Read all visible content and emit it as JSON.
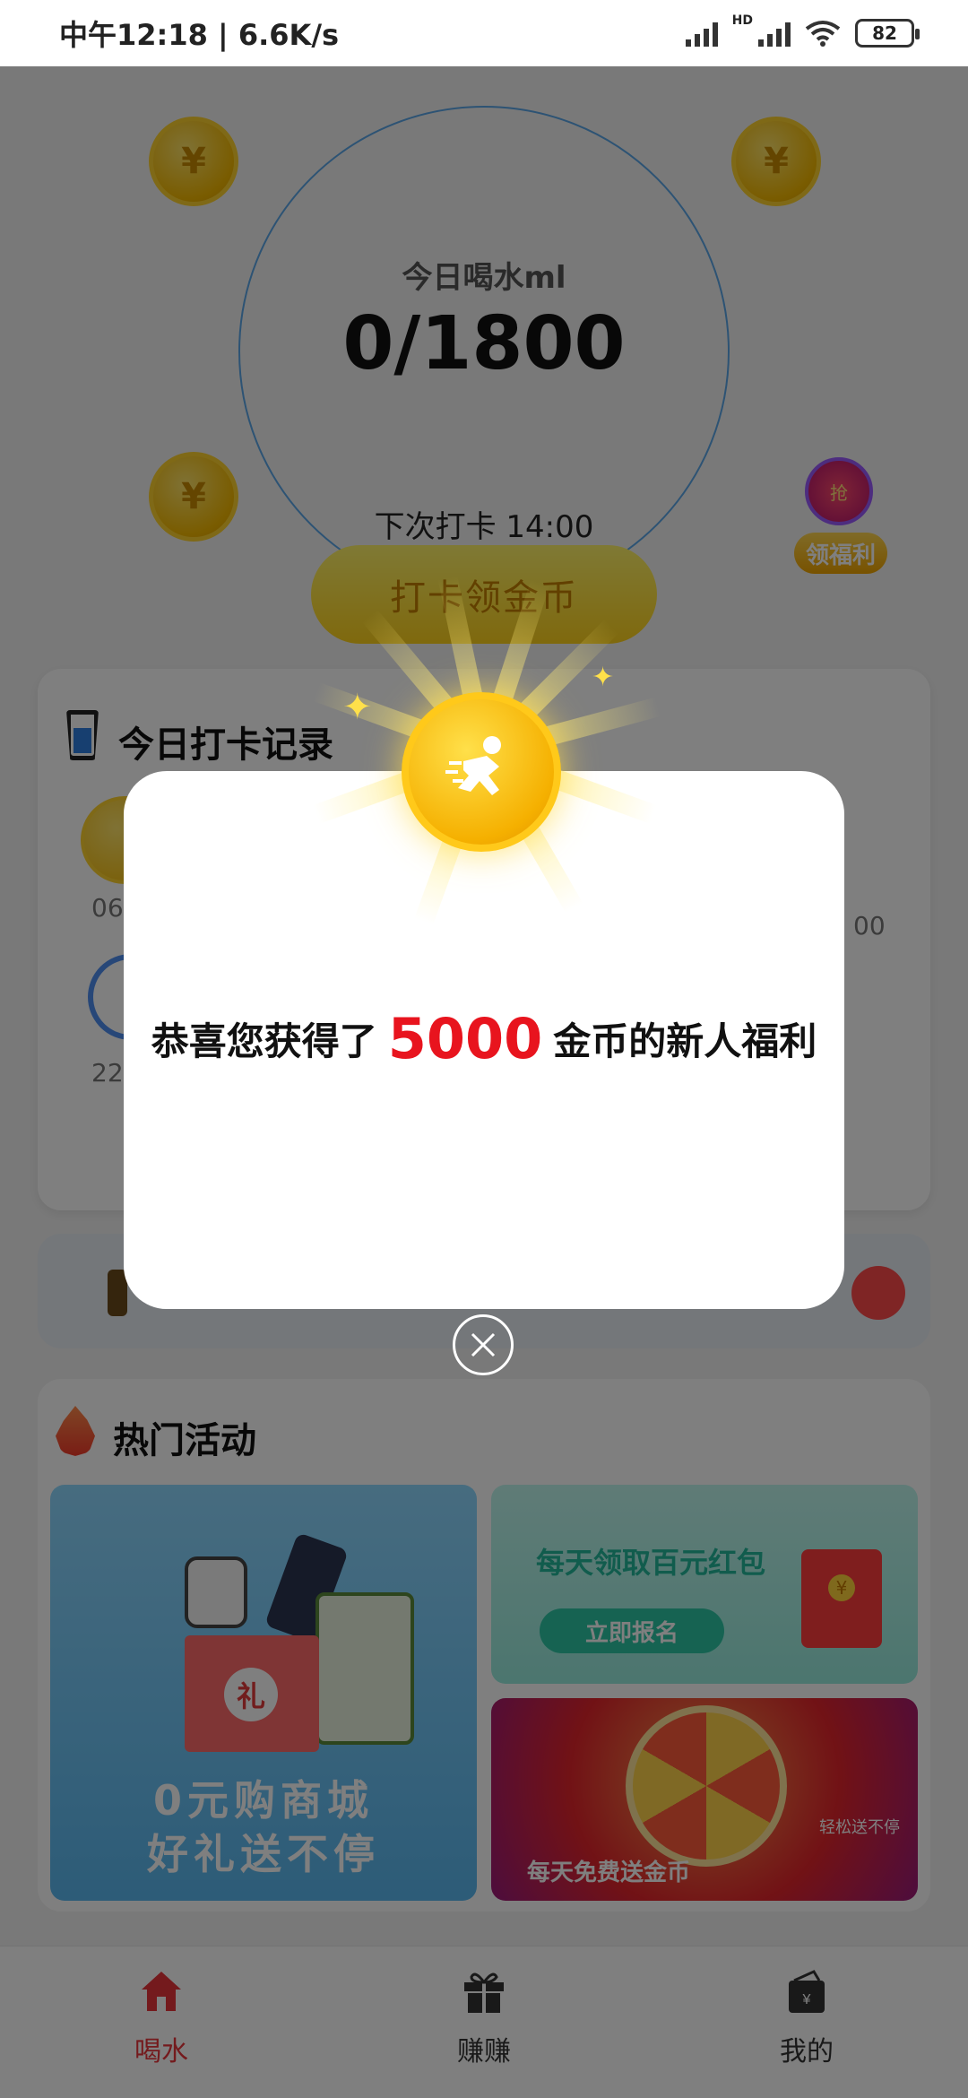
{
  "status_bar": {
    "time_speed": "中午12:18 | 6.6K/s",
    "hd": "HD",
    "battery": "82"
  },
  "water": {
    "label": "今日喝水ml",
    "value": "0/1800",
    "next_checkin_label": "下次打卡  14:00",
    "checkin_button": "打卡领金币"
  },
  "welfare": {
    "badge_text": "抢",
    "button": "领福利"
  },
  "record": {
    "title": "今日打卡记录",
    "times": [
      "06",
      "22",
      "00"
    ]
  },
  "hot": {
    "title": "热门活动",
    "shop_line1": "0元购商城",
    "shop_line2": "好礼送不停",
    "shop_box_char": "礼",
    "redpack_title": "每天领取百元红包",
    "redpack_button": "立即报名",
    "wheel_text": "每天免费送金币",
    "wheel_side": "轻松送不停"
  },
  "nav": {
    "items": [
      {
        "label": "喝水",
        "icon": "home-icon"
      },
      {
        "label": "赚赚",
        "icon": "gift-icon"
      },
      {
        "label": "我的",
        "icon": "wallet-icon"
      }
    ]
  },
  "dialog": {
    "prefix": "恭喜您获得了",
    "amount": "5000",
    "suffix": "金币的新人福利",
    "close_icon": "close-icon"
  },
  "colors": {
    "accent_red": "#e8141e",
    "coin_gold": "#f5b000",
    "nav_active": "#e8343b"
  }
}
